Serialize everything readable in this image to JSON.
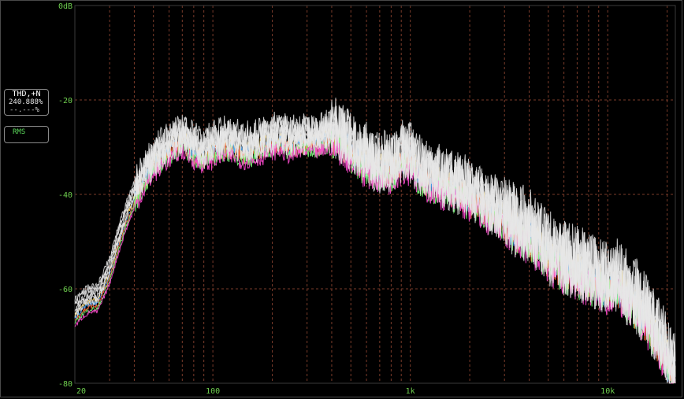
{
  "widgets": {
    "thd": {
      "title": "THD,+N",
      "value": "240.888%",
      "sub": "--.---%"
    },
    "rms": {
      "title": "RMS"
    }
  },
  "colors": {
    "background": "#000000",
    "grid": "#7a3b2a",
    "tick_label": "#6fcf4f",
    "trace_main": "#e6e6e6",
    "trace_alt": [
      "#ffd24a",
      "#4aa8ff",
      "#ff6a3a",
      "#7cff7c",
      "#ff4ad0"
    ]
  },
  "chart_data": {
    "type": "line",
    "xscale": "log",
    "xlim": [
      20,
      22000
    ],
    "ylim": [
      -80,
      0
    ],
    "x_ticks": [
      {
        "value": 20,
        "label": "20"
      },
      {
        "value": 100,
        "label": "100"
      },
      {
        "value": 1000,
        "label": "1k"
      },
      {
        "value": 10000,
        "label": "10k"
      }
    ],
    "y_ticks": [
      {
        "value": 0,
        "label": "0dB"
      },
      {
        "value": -20,
        "label": "-20"
      },
      {
        "value": -40,
        "label": "-40"
      },
      {
        "value": -60,
        "label": "-60"
      },
      {
        "value": -80,
        "label": "-80"
      }
    ],
    "grid": true,
    "series": [
      {
        "x": [
          20,
          22,
          24,
          26,
          28,
          30,
          33,
          36,
          40,
          45,
          50,
          56,
          63,
          71,
          80,
          90,
          100,
          112,
          125,
          140,
          160,
          180,
          200,
          224,
          250,
          280,
          315,
          355,
          400,
          450,
          500,
          560,
          630,
          710,
          800,
          900,
          1000,
          1120,
          1250,
          1400,
          1600,
          1800,
          2000,
          2240,
          2500,
          2800,
          3150,
          3550,
          4000,
          4500,
          5000,
          5600,
          6300,
          7100,
          8000,
          9000,
          10000,
          11200,
          12500,
          14000,
          16000,
          18000,
          20000,
          22000
        ],
        "y": [
          -64,
          -62,
          -61,
          -61,
          -58,
          -55,
          -49,
          -44,
          -39,
          -35,
          -32,
          -30,
          -28,
          -27,
          -29,
          -30,
          -29,
          -28,
          -28,
          -29,
          -29,
          -28,
          -27,
          -27,
          -28,
          -27,
          -27,
          -27,
          -26,
          -27,
          -29,
          -31,
          -32,
          -33,
          -33,
          -31,
          -31,
          -34,
          -35,
          -36,
          -37,
          -38,
          -39,
          -40,
          -42,
          -43,
          -44,
          -46,
          -47,
          -49,
          -51,
          -53,
          -54,
          -55,
          -56,
          -57,
          -58,
          -57,
          -60,
          -62,
          -65,
          -69,
          -73,
          -77
        ]
      }
    ]
  }
}
